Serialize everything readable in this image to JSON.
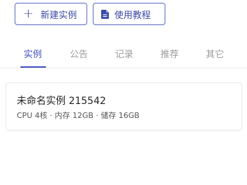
{
  "toolbar": {
    "new_instance_label": "新建实例",
    "tutorial_label": "使用教程"
  },
  "tabs": [
    {
      "label": "实例",
      "active": true
    },
    {
      "label": "公告",
      "active": false
    },
    {
      "label": "记录",
      "active": false
    },
    {
      "label": "推荐",
      "active": false
    },
    {
      "label": "其它",
      "active": false
    }
  ],
  "instances": [
    {
      "name": "未命名实例 215542",
      "specs": "CPU 4核 · 内存 12GB · 储存 16GB"
    }
  ],
  "colors": {
    "accent": "#3f4fbf",
    "inactive_tab": "#9a9a9a"
  },
  "icons": {
    "new_button_icon": "plus-icon",
    "tutorial_button_icon": "document-icon"
  }
}
